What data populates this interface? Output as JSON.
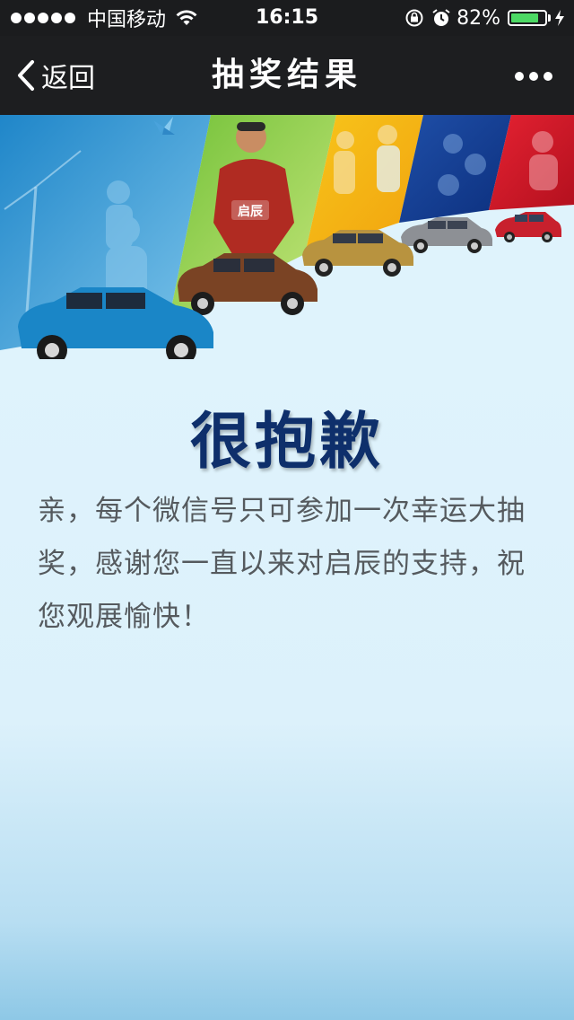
{
  "status_bar": {
    "carrier": "中国移动",
    "time": "16:15",
    "battery_percent": "82%",
    "battery_level": 0.82,
    "icons": [
      "signal-dots-icon",
      "wifi-icon",
      "orientation-lock-icon",
      "alarm-icon",
      "battery-icon",
      "charging-icon"
    ]
  },
  "nav": {
    "back_label": "返回",
    "title": "抽奖结果",
    "more_icon": "more-dots-icon"
  },
  "result": {
    "title": "很抱歉",
    "message": "亲，每个微信号只可参加一次幸运大抽奖，感谢您一直以来对启辰的支持，祝您观展愉快！"
  },
  "banner": {
    "player_shirt_text": "启辰"
  },
  "colors": {
    "status_bar_bg": "#1b1c1e",
    "nav_bg": "#1d1e20",
    "title_color": "#0e2f6b",
    "message_color": "#555a5e",
    "battery_green": "#4cd964"
  }
}
